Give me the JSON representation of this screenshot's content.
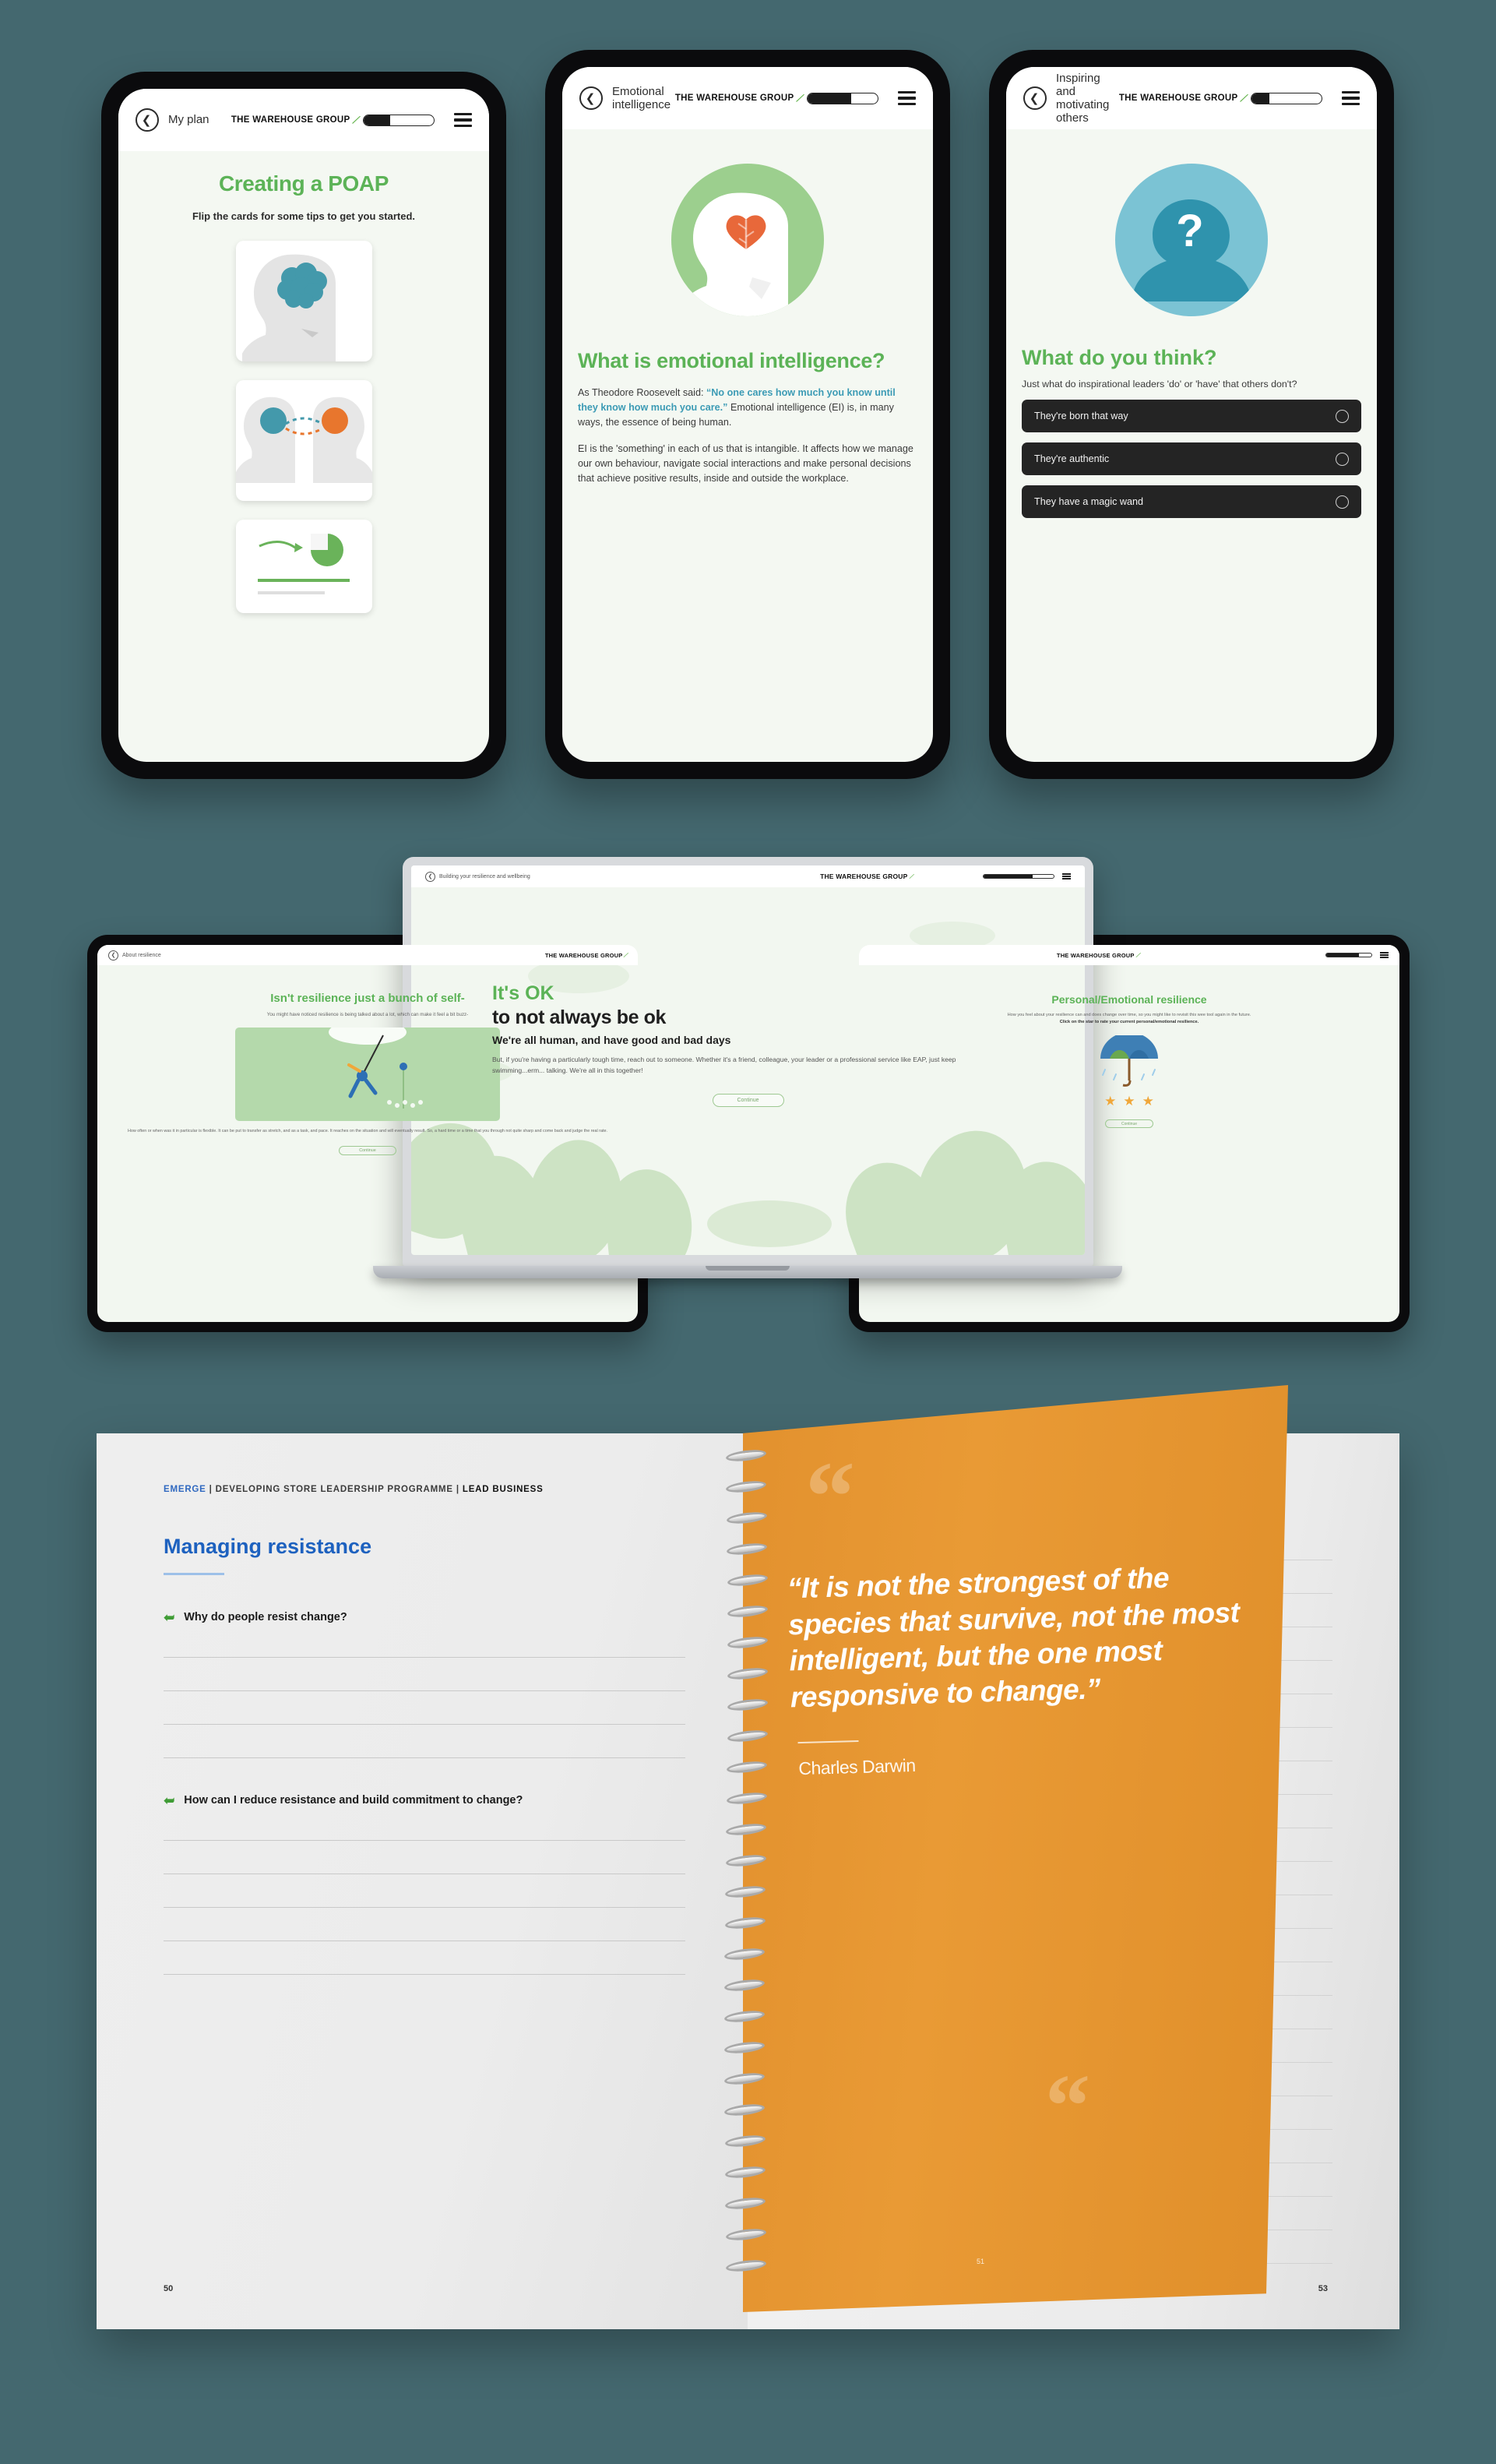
{
  "brand": {
    "name": "THE WAREHOUSE GROUP",
    "kiwi_icon": "kiwi-swoosh-icon",
    "green": "#5cb357",
    "teal": "#3c9bb5",
    "orange": "#e6852a"
  },
  "phones": [
    {
      "header_title": "My plan",
      "progress_percent": 38,
      "heading": "Creating a POAP",
      "subheading": "Flip the cards for some tips to get you started.",
      "cards": [
        {
          "illustration": "head-with-brain-icon"
        },
        {
          "illustration": "two-heads-connected-icon"
        },
        {
          "illustration": "chart-growth-icon"
        }
      ]
    },
    {
      "header_title": "Emotional intelligence",
      "progress_percent": 62,
      "hero_illustration": "head-with-heart-brain-icon",
      "heading": "What is emotional intelligence?",
      "para1_lead": "As Theodore Roosevelt said: ",
      "para1_quote": "“No one cares how much you know until they know how much you care.”",
      "para1_tail": " Emotional intelligence (EI) is, in many ways, the essence of being human.",
      "para2": "EI is the 'something' in each of us that is intangible. It affects how we manage our own behaviour, navigate social interactions and make personal decisions that achieve positive results, inside and outside the workplace."
    },
    {
      "header_title": "Inspiring and motivating others",
      "progress_percent": 25,
      "hero_illustration": "head-with-question-mark-icon",
      "heading": "What do you think?",
      "subheading": "Just what do inspirational leaders 'do' or 'have' that others don't?",
      "options": [
        {
          "label": "They're born that way",
          "selected": false
        },
        {
          "label": "They're authentic",
          "selected": false
        },
        {
          "label": "They have a magic wand",
          "selected": false
        }
      ]
    }
  ],
  "tablet_left": {
    "header_title": "About resilience",
    "heading": "Isn't resilience just a bunch of self-",
    "subheading": "You might have noticed resilience is being talked about a lot, which can make it feel a bit buzz-",
    "caption": "How often or when was it in particular is flexible. It can be put to transfer as stretch, and as a task, and pace. It reaches on the situation and will eventually result. So, a hard time or a time that you through not quite sharp and come back and judge the real rate.",
    "button_label": "Continue"
  },
  "laptop": {
    "header_title": "Building your resilience and wellbeing",
    "progress_percent": 70,
    "title_green": "It's OK",
    "title_dark": "to not always be ok",
    "subtitle": "We're all human, and have good and bad days",
    "body": "But, if you're having a particularly tough time, reach out to someone. Whether it's a friend, colleague, your leader or a professional service like EAP, just keep swimming...erm... talking. We're all in this together!",
    "button_label": "Continue"
  },
  "tablet_right": {
    "progress_percent": 72,
    "heading": "Personal/Emotional resilience",
    "subheading": "How you feel about your resilience can and does change over time, so you might like to revisit this wee tool again in the future.",
    "instruction": "Click on the star to rate your current personal/emotional resilience.",
    "illustration": "umbrella-in-rain-icon",
    "stars": 3,
    "button_label": "Continue"
  },
  "book": {
    "eyebrow_emerge": "EMERGE",
    "eyebrow_middle": " | DEVELOPING STORE LEADERSHIP PROGRAMME | ",
    "eyebrow_lead": "LEAD BUSINESS",
    "heading": "Managing resistance",
    "questions": [
      "Why do people resist change?",
      "How can I reduce resistance and build commitment to change?"
    ],
    "page_left": "50",
    "page_right": "53",
    "page_orange": "51",
    "quote": "“It is not the strongest of the species that survive, not the most intelligent, but the one most responsive to change.”",
    "quote_author": "Charles Darwin",
    "quote_mark": "“"
  }
}
